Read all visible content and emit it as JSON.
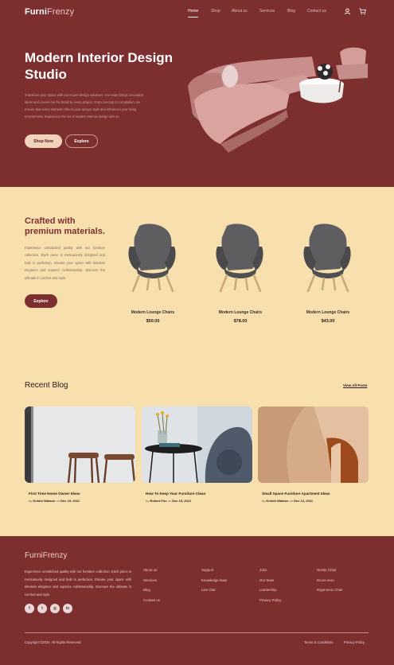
{
  "header": {
    "logo_part1": "Furni",
    "logo_part2": "Frenzy",
    "nav": [
      "Home",
      "Shop",
      "About us",
      "Services",
      "Blog",
      "Contact us"
    ],
    "icons": [
      "user-icon",
      "cart-icon"
    ]
  },
  "hero": {
    "title": "Modern Interior Design Studio",
    "description": "Transform your space with our expert design solutions. Our team brings innovative ideas and a keen eye for detail to every project. From concept to completion, we ensure that every element reflects your unique style and enhances your living environment. Experience the art of modern interior design with us.",
    "shop_label": "Shop Now",
    "explore_label": "Explore"
  },
  "products_section": {
    "title": "Crafted with premium materials.",
    "description": "Experience unmatched quality with our furniture collection. Each piece is meticulously designed and built to perfection. Elevate your space with timeless elegance and superior craftsmanship. Discover the ultimate in comfort and style.",
    "explore_label": "Explore",
    "products": [
      {
        "name": "Modern Lounge Chairs",
        "price": "$50.00"
      },
      {
        "name": "Modern Lounge Chairs",
        "price": "$78.00"
      },
      {
        "name": "Modern Lounge Chairs",
        "price": "$43.00"
      }
    ]
  },
  "blog": {
    "title": "Recent Blog",
    "view_all": "View All Posts",
    "by": "by",
    "on": "on",
    "posts": [
      {
        "title": "First Time Home Owner Ideas",
        "author": "Kristin Watson",
        "date": "Dec 19, 2021"
      },
      {
        "title": "How To Keep Your Furniture Clean",
        "author": "Robert Fox",
        "date": "Dec 15, 2021"
      },
      {
        "title": "Small Space Furniture Apartment Ideas",
        "author": "Kristin Watson",
        "date": "Dec 12, 2021"
      }
    ]
  },
  "footer": {
    "logo": "FurniFrenzy",
    "description": "Experience unmatched quality with our furniture collection. Each piece is meticulously designed and built to perfection. Elevate your space with timeless elegance and superior craftsmanship. Discover the ultimate in comfort and style.",
    "social_icons": [
      "facebook-icon",
      "twitter-icon",
      "instagram-icon",
      "linkedin-icon"
    ],
    "col1": [
      "About us",
      "Services",
      "Blog",
      "Contact us"
    ],
    "col2": [
      "Support",
      "Knowledge base",
      "Live chat"
    ],
    "col3": [
      "Jobs",
      "Our team",
      "Leadership",
      "Privacy Policy"
    ],
    "col4": [
      "Nordic Chair",
      "Kruzo Aero",
      "Ergonomic Chair"
    ],
    "copyright": "Copyright ©2024. All Rights Reserved.",
    "terms": "Terms & Conditions",
    "privacy": "Privacy Policy"
  },
  "colors": {
    "brand": "#7d2f2f",
    "section_bg": "#f8dfae",
    "accent": "#f3d2bc"
  }
}
